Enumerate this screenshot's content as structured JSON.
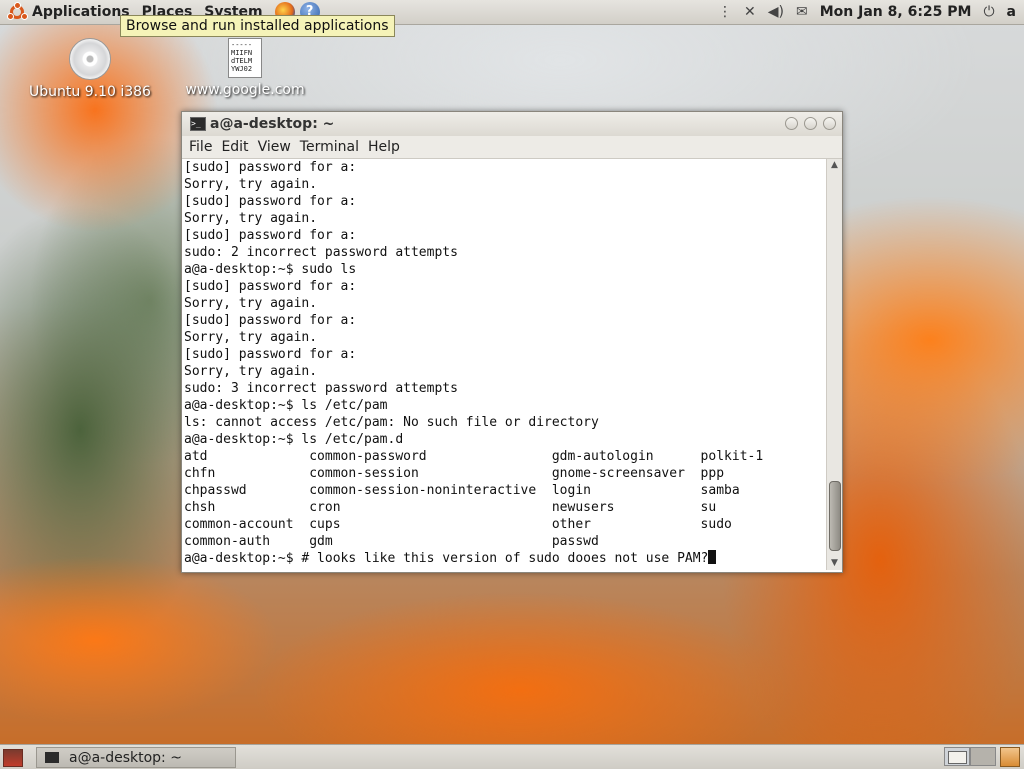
{
  "top_panel": {
    "menus": [
      "Applications",
      "Places",
      "System"
    ],
    "clock": "Mon Jan  8,  6:25 PM",
    "user": "a"
  },
  "tooltip": "Browse and run installed applications",
  "desktop": {
    "icons": [
      {
        "label": "Ubuntu 9.10 i386",
        "icon": "cd-icon"
      },
      {
        "label": "www.google.com",
        "icon": "document-icon",
        "preview": "-----\nMIIFN\ndTELM\nYWJ02"
      }
    ]
  },
  "terminal_window": {
    "title": "a@a-desktop: ~",
    "menu": [
      "File",
      "Edit",
      "View",
      "Terminal",
      "Help"
    ],
    "lines": [
      "[sudo] password for a:",
      "Sorry, try again.",
      "[sudo] password for a:",
      "Sorry, try again.",
      "[sudo] password for a:",
      "sudo: 2 incorrect password attempts",
      "a@a-desktop:~$ sudo ls",
      "[sudo] password for a:",
      "Sorry, try again.",
      "[sudo] password for a:",
      "Sorry, try again.",
      "[sudo] password for a:",
      "Sorry, try again.",
      "sudo: 3 incorrect password attempts",
      "a@a-desktop:~$ ls /etc/pam",
      "ls: cannot access /etc/pam: No such file or directory",
      "a@a-desktop:~$ ls /etc/pam.d",
      "atd             common-password                gdm-autologin      polkit-1",
      "chfn            common-session                 gnome-screensaver  ppp",
      "chpasswd        common-session-noninteractive  login              samba",
      "chsh            cron                           newusers           su",
      "common-account  cups                           other              sudo",
      "common-auth     gdm                            passwd"
    ],
    "prompt_line": "a@a-desktop:~$ # looks like this version of sudo dooes not use PAM?"
  },
  "bottom_panel": {
    "task": "a@a-desktop: ~"
  }
}
